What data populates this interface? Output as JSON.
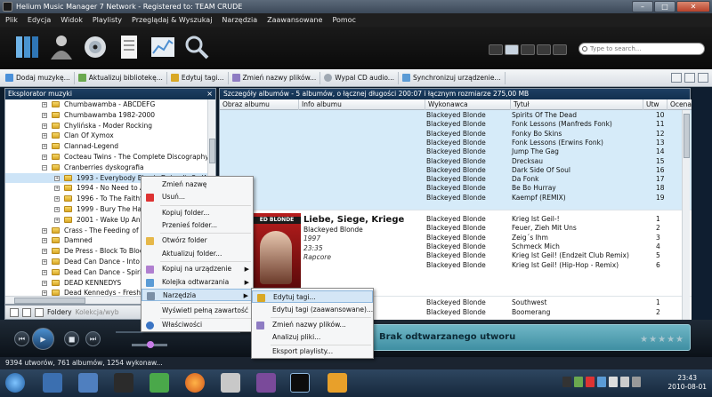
{
  "window": {
    "title": "Helium Music Manager 7 Network - Registered to: TEAM CRUDE"
  },
  "menu": [
    "Plik",
    "Edycja",
    "Widok",
    "Playlisty",
    "Przeglądaj & Wyszukaj",
    "Narzędzia",
    "Zaawansowane",
    "Pomoc"
  ],
  "search": {
    "placeholder": "Type to search..."
  },
  "toolbar": {
    "add": "Dodaj muzykę...",
    "update": "Aktualizuj bibliotekę...",
    "edit": "Edytuj tagi...",
    "rename": "Zmień nazwy plików...",
    "rip": "Wypal CD audio...",
    "sync": "Synchronizuj urządzenie..."
  },
  "explorer": {
    "title": "Eksplorator muzyki",
    "items": [
      "Chumbawamba - ABCDEFG",
      "Chumbawamba 1982-2000",
      "Chylińska - Moder Rocking",
      "Clan Of Xymox",
      "Clannad-Legend",
      "Cocteau Twins - The Complete Discography ar",
      "Cranberries dyskografia",
      "1993 - Everybody Else is Doing It, So Why C",
      "1994 - No Need to Arg",
      "1996 - To The Faithful",
      "1999 - Bury The Hatch",
      "2001 - Wake Up And S",
      "Crass - The Feeding of th",
      "Damned",
      "De Press - Block To Block",
      "Dead Can Dance - Into Th",
      "Dead Can Dance - Spiritc",
      "DEAD KENNEDYS",
      "Dead Kennedys - Fresh F"
    ]
  },
  "bottombar": {
    "folders": "Foldery",
    "collection": "Kolekcja/wyb"
  },
  "albums": {
    "header": "Szczegóły albumów - 5 albumów, o łącznej długości 200:07 i łącznym rozmiarze 275,00 MB",
    "columns": [
      "Obraz albumu",
      "Info albumu",
      "Wykonawca",
      "Tytuł",
      "Utw",
      "Ocena"
    ],
    "group1": [
      {
        "artist": "Blackeyed Blonde",
        "title": "Spirits Of The Dead",
        "nr": "10"
      },
      {
        "artist": "Blackeyed Blonde",
        "title": "Fonk Lessons (Manfreds Fonk)",
        "nr": "11"
      },
      {
        "artist": "Blackeyed Blonde",
        "title": "Fonky Bo Skins",
        "nr": "12"
      },
      {
        "artist": "Blackeyed Blonde",
        "title": "Fonk Lessons (Erwins Fonk)",
        "nr": "13"
      },
      {
        "artist": "Blackeyed Blonde",
        "title": "Jump The Gag",
        "nr": "14"
      },
      {
        "artist": "Blackeyed Blonde",
        "title": "Drecksau",
        "nr": "15"
      },
      {
        "artist": "Blackeyed Blonde",
        "title": "Dark Side Of Soul",
        "nr": "16"
      },
      {
        "artist": "Blackeyed Blonde",
        "title": "Da Fonk",
        "nr": "17"
      },
      {
        "artist": "Blackeyed Blonde",
        "title": "Be Bo Hurray",
        "nr": "18"
      },
      {
        "artist": "Blackeyed Blonde",
        "title": "Kaempf (REMIX)",
        "nr": "19"
      }
    ],
    "album2": {
      "art_text": "ED BLONDE",
      "title": "Liebe, Siege, Kriege",
      "artist": "Blackeyed Blonde",
      "year": "1997",
      "length": "23:35",
      "genre": "Rapcore",
      "tracks": [
        {
          "artist": "Blackeyed Blonde",
          "title": "Krieg Ist Geil-!",
          "nr": "1"
        },
        {
          "artist": "Blackeyed Blonde",
          "title": "Feuer, Zieh Mit Uns",
          "nr": "2"
        },
        {
          "artist": "Blackeyed Blonde",
          "title": "Zeig´s Ihm",
          "nr": "3"
        },
        {
          "artist": "Blackeyed Blonde",
          "title": "Schmeck Mich",
          "nr": "4"
        },
        {
          "artist": "Blackeyed Blonde",
          "title": "Krieg Ist Geil! (Endzeit Club Remix)",
          "nr": "5"
        },
        {
          "artist": "Blackeyed Blonde",
          "title": "Krieg Ist Geil! (Hip-Hop - Remix)",
          "nr": "6"
        }
      ]
    },
    "group3": [
      {
        "artist": "Blackeyed Blonde",
        "title": "Southwest",
        "nr": "1"
      },
      {
        "artist": "Blackeyed Blonde",
        "title": "Boomerang",
        "nr": "2"
      }
    ]
  },
  "context_menu": {
    "items": [
      "Zmień nazwę",
      "Usuń...",
      "Kopiuj folder...",
      "Przenieś folder...",
      "Otwórz folder",
      "Aktualizuj folder...",
      "Kopiuj na urządzenie",
      "Kolejka odtwarzania",
      "Narzędzia",
      "Wyświetl pełną zawartość",
      "Właściwości"
    ],
    "submenu": [
      "Edytuj tagi...",
      "Edytuj tagi (zaawansowane)...",
      "Zmień nazwy plików...",
      "Analizuj pliki...",
      "Eksport playlisty..."
    ]
  },
  "player": {
    "now_playing": "Brak odtwarzanego utworu",
    "stars": "★★★★★"
  },
  "status": {
    "text": "9394 utworów, 761 albumów, 1254 wykonaw..."
  },
  "taskbar": {
    "time": "23:43",
    "date": "2010-08-01"
  },
  "colors": {
    "accent": "#12304f",
    "selection": "#d6ebf9",
    "player": "#4f9fb2"
  }
}
